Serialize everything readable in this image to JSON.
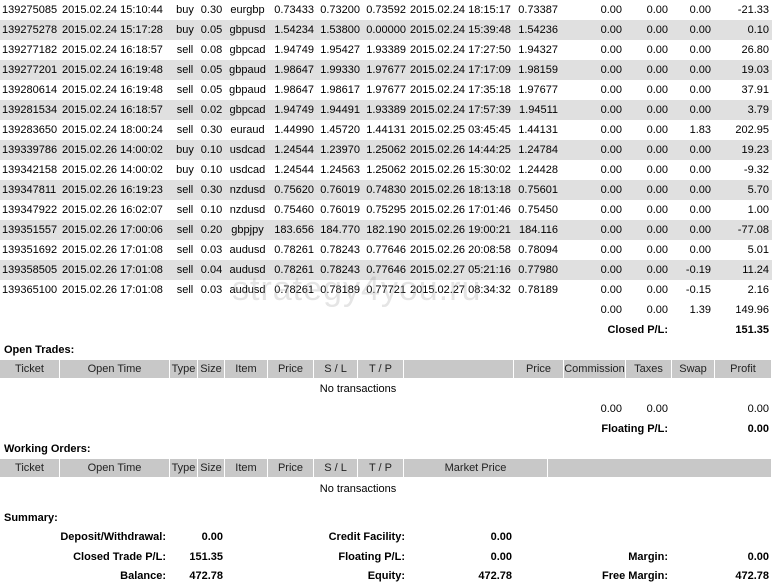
{
  "closed_trades": [
    [
      "139275085",
      "2015.02.24 15:10:44",
      "buy",
      "0.30",
      "eurgbp",
      "0.73433",
      "0.73200",
      "0.73592",
      "2015.02.24 18:15:17",
      "0.73387",
      "0.00",
      "0.00",
      "0.00",
      "-21.33"
    ],
    [
      "139275278",
      "2015.02.24 15:17:28",
      "buy",
      "0.05",
      "gbpusd",
      "1.54234",
      "1.53800",
      "0.00000",
      "2015.02.24 15:39:48",
      "1.54236",
      "0.00",
      "0.00",
      "0.00",
      "0.10"
    ],
    [
      "139277182",
      "2015.02.24 16:18:57",
      "sell",
      "0.08",
      "gbpcad",
      "1.94749",
      "1.95427",
      "1.93389",
      "2015.02.24 17:27:50",
      "1.94327",
      "0.00",
      "0.00",
      "0.00",
      "26.80"
    ],
    [
      "139277201",
      "2015.02.24 16:19:48",
      "sell",
      "0.05",
      "gbpaud",
      "1.98647",
      "1.99330",
      "1.97677",
      "2015.02.24 17:17:09",
      "1.98159",
      "0.00",
      "0.00",
      "0.00",
      "19.03"
    ],
    [
      "139280614",
      "2015.02.24 16:19:48",
      "sell",
      "0.05",
      "gbpaud",
      "1.98647",
      "1.98617",
      "1.97677",
      "2015.02.24 17:35:18",
      "1.97677",
      "0.00",
      "0.00",
      "0.00",
      "37.91"
    ],
    [
      "139281534",
      "2015.02.24 16:18:57",
      "sell",
      "0.02",
      "gbpcad",
      "1.94749",
      "1.94491",
      "1.93389",
      "2015.02.24 17:57:39",
      "1.94511",
      "0.00",
      "0.00",
      "0.00",
      "3.79"
    ],
    [
      "139283650",
      "2015.02.24 18:00:24",
      "sell",
      "0.30",
      "euraud",
      "1.44990",
      "1.45720",
      "1.44131",
      "2015.02.25 03:45:45",
      "1.44131",
      "0.00",
      "0.00",
      "1.83",
      "202.95"
    ],
    [
      "139339786",
      "2015.02.26 14:00:02",
      "buy",
      "0.10",
      "usdcad",
      "1.24544",
      "1.23970",
      "1.25062",
      "2015.02.26 14:44:25",
      "1.24784",
      "0.00",
      "0.00",
      "0.00",
      "19.23"
    ],
    [
      "139342158",
      "2015.02.26 14:00:02",
      "buy",
      "0.10",
      "usdcad",
      "1.24544",
      "1.24563",
      "1.25062",
      "2015.02.26 15:30:02",
      "1.24428",
      "0.00",
      "0.00",
      "0.00",
      "-9.32"
    ],
    [
      "139347811",
      "2015.02.26 16:19:23",
      "sell",
      "0.30",
      "nzdusd",
      "0.75620",
      "0.76019",
      "0.74830",
      "2015.02.26 18:13:18",
      "0.75601",
      "0.00",
      "0.00",
      "0.00",
      "5.70"
    ],
    [
      "139347922",
      "2015.02.26 16:02:07",
      "sell",
      "0.10",
      "nzdusd",
      "0.75460",
      "0.76019",
      "0.75295",
      "2015.02.26 17:01:46",
      "0.75450",
      "0.00",
      "0.00",
      "0.00",
      "1.00"
    ],
    [
      "139351557",
      "2015.02.26 17:00:06",
      "sell",
      "0.20",
      "gbpjpy",
      "183.656",
      "184.770",
      "182.190",
      "2015.02.26 19:00:21",
      "184.116",
      "0.00",
      "0.00",
      "0.00",
      "-77.08"
    ],
    [
      "139351692",
      "2015.02.26 17:01:08",
      "sell",
      "0.03",
      "audusd",
      "0.78261",
      "0.78243",
      "0.77646",
      "2015.02.26 20:08:58",
      "0.78094",
      "0.00",
      "0.00",
      "0.00",
      "5.01"
    ],
    [
      "139358505",
      "2015.02.26 17:01:08",
      "sell",
      "0.04",
      "audusd",
      "0.78261",
      "0.78243",
      "0.77646",
      "2015.02.27 05:21:16",
      "0.77980",
      "0.00",
      "0.00",
      "-0.19",
      "11.24"
    ],
    [
      "139365100",
      "2015.02.26 17:01:08",
      "sell",
      "0.03",
      "audusd",
      "0.78261",
      "0.78189",
      "0.77721",
      "2015.02.27 08:34:32",
      "0.78189",
      "0.00",
      "0.00",
      "-0.15",
      "2.16"
    ]
  ],
  "closed_totals": {
    "commission": "0.00",
    "taxes": "0.00",
    "swap": "1.39",
    "profit": "149.96"
  },
  "closed_pl": {
    "label": "Closed P/L:",
    "value": "151.35"
  },
  "watermark": "strategy4you.ru",
  "open_trades": {
    "title": "Open Trades:",
    "headers": [
      "Ticket",
      "Open Time",
      "Type",
      "Size",
      "Item",
      "Price",
      "S / L",
      "T / P",
      "",
      "Price",
      "Commission",
      "Taxes",
      "Swap",
      "Profit"
    ],
    "empty": "No transactions",
    "totals": {
      "commission": "0.00",
      "taxes": "0.00",
      "profit": "0.00"
    },
    "floating_label": "Floating P/L:",
    "floating_value": "0.00"
  },
  "working_orders": {
    "title": "Working Orders:",
    "headers": [
      "Ticket",
      "Open Time",
      "Type",
      "Size",
      "Item",
      "Price",
      "S / L",
      "T / P",
      "Market Price"
    ],
    "empty": "No transactions"
  },
  "summary": {
    "title": "Summary:",
    "deposit_label": "Deposit/Withdrawal:",
    "deposit_value": "0.00",
    "credit_label": "Credit Facility:",
    "credit_value": "0.00",
    "closed_label": "Closed Trade P/L:",
    "closed_value": "151.35",
    "floating_label": "Floating P/L:",
    "floating_value": "0.00",
    "margin_label": "Margin:",
    "margin_value": "0.00",
    "balance_label": "Balance:",
    "balance_value": "472.78",
    "equity_label": "Equity:",
    "equity_value": "472.78",
    "free_margin_label": "Free Margin:",
    "free_margin_value": "472.78"
  }
}
